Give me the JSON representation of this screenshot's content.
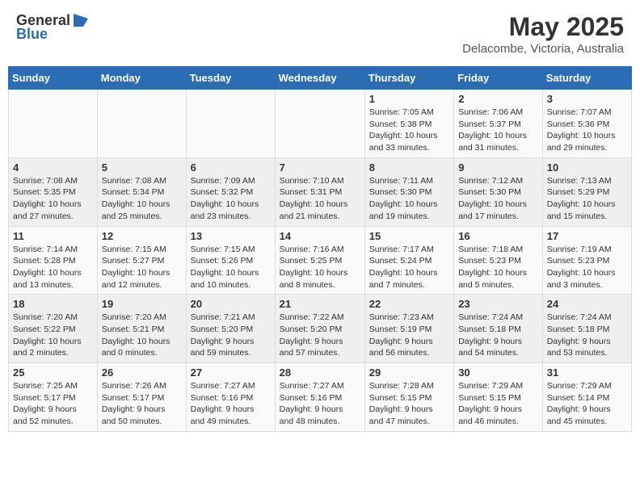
{
  "header": {
    "logo_general": "General",
    "logo_blue": "Blue",
    "title": "May 2025",
    "subtitle": "Delacombe, Victoria, Australia"
  },
  "calendar": {
    "days_of_week": [
      "Sunday",
      "Monday",
      "Tuesday",
      "Wednesday",
      "Thursday",
      "Friday",
      "Saturday"
    ],
    "weeks": [
      [
        {
          "day": "",
          "info": ""
        },
        {
          "day": "",
          "info": ""
        },
        {
          "day": "",
          "info": ""
        },
        {
          "day": "",
          "info": ""
        },
        {
          "day": "1",
          "info": "Sunrise: 7:05 AM\nSunset: 5:38 PM\nDaylight: 10 hours\nand 33 minutes."
        },
        {
          "day": "2",
          "info": "Sunrise: 7:06 AM\nSunset: 5:37 PM\nDaylight: 10 hours\nand 31 minutes."
        },
        {
          "day": "3",
          "info": "Sunrise: 7:07 AM\nSunset: 5:36 PM\nDaylight: 10 hours\nand 29 minutes."
        }
      ],
      [
        {
          "day": "4",
          "info": "Sunrise: 7:08 AM\nSunset: 5:35 PM\nDaylight: 10 hours\nand 27 minutes."
        },
        {
          "day": "5",
          "info": "Sunrise: 7:08 AM\nSunset: 5:34 PM\nDaylight: 10 hours\nand 25 minutes."
        },
        {
          "day": "6",
          "info": "Sunrise: 7:09 AM\nSunset: 5:32 PM\nDaylight: 10 hours\nand 23 minutes."
        },
        {
          "day": "7",
          "info": "Sunrise: 7:10 AM\nSunset: 5:31 PM\nDaylight: 10 hours\nand 21 minutes."
        },
        {
          "day": "8",
          "info": "Sunrise: 7:11 AM\nSunset: 5:30 PM\nDaylight: 10 hours\nand 19 minutes."
        },
        {
          "day": "9",
          "info": "Sunrise: 7:12 AM\nSunset: 5:30 PM\nDaylight: 10 hours\nand 17 minutes."
        },
        {
          "day": "10",
          "info": "Sunrise: 7:13 AM\nSunset: 5:29 PM\nDaylight: 10 hours\nand 15 minutes."
        }
      ],
      [
        {
          "day": "11",
          "info": "Sunrise: 7:14 AM\nSunset: 5:28 PM\nDaylight: 10 hours\nand 13 minutes."
        },
        {
          "day": "12",
          "info": "Sunrise: 7:15 AM\nSunset: 5:27 PM\nDaylight: 10 hours\nand 12 minutes."
        },
        {
          "day": "13",
          "info": "Sunrise: 7:15 AM\nSunset: 5:26 PM\nDaylight: 10 hours\nand 10 minutes."
        },
        {
          "day": "14",
          "info": "Sunrise: 7:16 AM\nSunset: 5:25 PM\nDaylight: 10 hours\nand 8 minutes."
        },
        {
          "day": "15",
          "info": "Sunrise: 7:17 AM\nSunset: 5:24 PM\nDaylight: 10 hours\nand 7 minutes."
        },
        {
          "day": "16",
          "info": "Sunrise: 7:18 AM\nSunset: 5:23 PM\nDaylight: 10 hours\nand 5 minutes."
        },
        {
          "day": "17",
          "info": "Sunrise: 7:19 AM\nSunset: 5:23 PM\nDaylight: 10 hours\nand 3 minutes."
        }
      ],
      [
        {
          "day": "18",
          "info": "Sunrise: 7:20 AM\nSunset: 5:22 PM\nDaylight: 10 hours\nand 2 minutes."
        },
        {
          "day": "19",
          "info": "Sunrise: 7:20 AM\nSunset: 5:21 PM\nDaylight: 10 hours\nand 0 minutes."
        },
        {
          "day": "20",
          "info": "Sunrise: 7:21 AM\nSunset: 5:20 PM\nDaylight: 9 hours\nand 59 minutes."
        },
        {
          "day": "21",
          "info": "Sunrise: 7:22 AM\nSunset: 5:20 PM\nDaylight: 9 hours\nand 57 minutes."
        },
        {
          "day": "22",
          "info": "Sunrise: 7:23 AM\nSunset: 5:19 PM\nDaylight: 9 hours\nand 56 minutes."
        },
        {
          "day": "23",
          "info": "Sunrise: 7:24 AM\nSunset: 5:18 PM\nDaylight: 9 hours\nand 54 minutes."
        },
        {
          "day": "24",
          "info": "Sunrise: 7:24 AM\nSunset: 5:18 PM\nDaylight: 9 hours\nand 53 minutes."
        }
      ],
      [
        {
          "day": "25",
          "info": "Sunrise: 7:25 AM\nSunset: 5:17 PM\nDaylight: 9 hours\nand 52 minutes."
        },
        {
          "day": "26",
          "info": "Sunrise: 7:26 AM\nSunset: 5:17 PM\nDaylight: 9 hours\nand 50 minutes."
        },
        {
          "day": "27",
          "info": "Sunrise: 7:27 AM\nSunset: 5:16 PM\nDaylight: 9 hours\nand 49 minutes."
        },
        {
          "day": "28",
          "info": "Sunrise: 7:27 AM\nSunset: 5:16 PM\nDaylight: 9 hours\nand 48 minutes."
        },
        {
          "day": "29",
          "info": "Sunrise: 7:28 AM\nSunset: 5:15 PM\nDaylight: 9 hours\nand 47 minutes."
        },
        {
          "day": "30",
          "info": "Sunrise: 7:29 AM\nSunset: 5:15 PM\nDaylight: 9 hours\nand 46 minutes."
        },
        {
          "day": "31",
          "info": "Sunrise: 7:29 AM\nSunset: 5:14 PM\nDaylight: 9 hours\nand 45 minutes."
        }
      ]
    ]
  }
}
